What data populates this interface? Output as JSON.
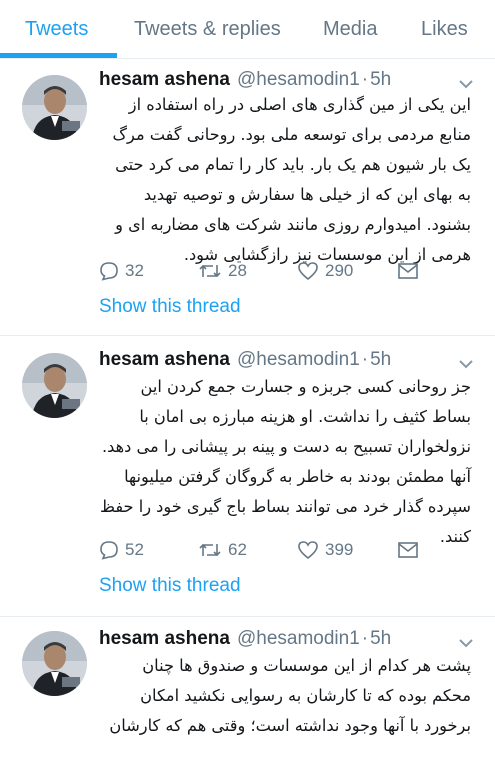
{
  "tabs": [
    {
      "label": "Tweets",
      "active": true
    },
    {
      "label": "Tweets & replies",
      "active": false
    },
    {
      "label": "Media",
      "active": false
    },
    {
      "label": "Likes",
      "active": false
    }
  ],
  "accent_color": "#1da1f2",
  "secondary_text_color": "#657786",
  "tweets": [
    {
      "name": "hesam ashena",
      "handle": "@hesamodin1",
      "separator": "·",
      "time": "5h",
      "text": "این یکی از مین گذاری های اصلی در راه استفاده از منابع مردمی برای توسعه ملی بود. روحانی گفت مرگ یک بار شیون هم یک بار. باید کار را تمام می کرد حتی به بهای این که از خیلی ها سفارش و توصیه تهدید بشنود. امیدوارم روزی مانند شرکت های مضاربه ای و هرمی از این موسسات نیز رازگشایی شود.",
      "replies": "32",
      "retweets": "28",
      "likes": "290",
      "show_thread": "Show this thread"
    },
    {
      "name": "hesam ashena",
      "handle": "@hesamodin1",
      "separator": "·",
      "time": "5h",
      "text": "جز روحانی کسی جربزه و جسارت جمع کردن این بساط کثیف را نداشت. او هزینه مبارزه بی امان با نزولخواران تسبیح به دست و پینه بر پیشانی را می دهد. آنها مطمئن بودند به خاطر به گروگان گرفتن میلیونها سپرده گذار خرد می توانند بساط باج گیری خود را حفظ کنند.",
      "replies": "52",
      "retweets": "62",
      "likes": "399",
      "show_thread": "Show this thread"
    },
    {
      "name": "hesam ashena",
      "handle": "@hesamodin1",
      "separator": "·",
      "time": "5h",
      "text": "پشت هر کدام از این موسسات و صندوق ها چنان محکم بوده که تا کارشان به رسوایی نکشید امکان برخورد با آنها وجود نداشته است؛ وقتی هم که کارشان"
    }
  ],
  "icons": {
    "reply": "reply-icon",
    "retweet": "retweet-icon",
    "like": "heart-icon",
    "share": "share-envelope-icon",
    "more": "chevron-down-icon",
    "avatar": "profile-photo"
  }
}
